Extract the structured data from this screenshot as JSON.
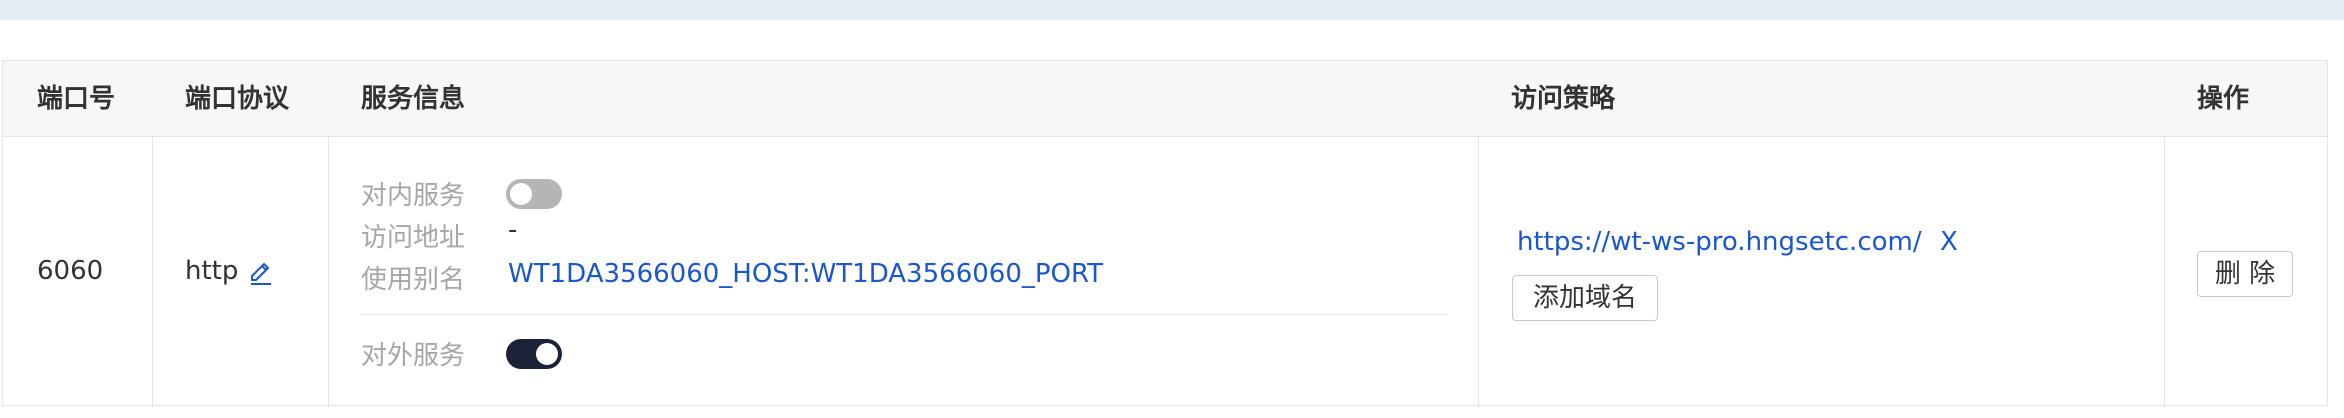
{
  "table": {
    "headers": {
      "port": "端口号",
      "protocol": "端口协议",
      "service_info": "服务信息",
      "access_policy": "访问策略",
      "actions": "操作"
    },
    "rows": [
      {
        "port": "6060",
        "protocol": "http",
        "service": {
          "internal_label": "对内服务",
          "internal_enabled": false,
          "address_label": "访问地址",
          "address_value": "-",
          "alias_label": "使用别名",
          "alias_value": "WT1DA3566060_HOST:WT1DA3566060_PORT",
          "external_label": "对外服务",
          "external_enabled": true
        },
        "policy": {
          "domain": "https://wt-ws-pro.hngsetc.com/",
          "remove_glyph": "X",
          "add_domain_label": "添加域名"
        },
        "delete_label": "删 除"
      }
    ]
  },
  "icons": {
    "edit": "pencil-edit-icon",
    "remove": "close-icon"
  },
  "colors": {
    "link": "#1a56cc",
    "toggle_on": "#1c2238",
    "toggle_off": "#b5b5b5",
    "header_bg": "#f7f7f7",
    "top_band": "#e6edf2"
  }
}
